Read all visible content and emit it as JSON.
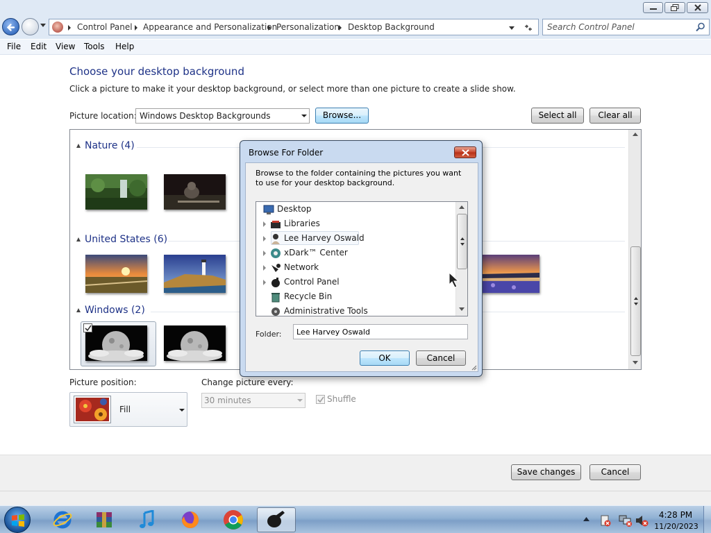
{
  "address_bar": {
    "crumbs": [
      "Control Panel",
      "Appearance and Personalization",
      "Personalization",
      "Desktop Background"
    ],
    "search_placeholder": "Search Control Panel"
  },
  "menu": [
    "File",
    "Edit",
    "View",
    "Tools",
    "Help"
  ],
  "main": {
    "title": "Choose your desktop background",
    "instructions": "Click a picture to make it your desktop background, or select more than one picture to create a slide show.",
    "picture_location_label": "Picture location:",
    "picture_location_value": "Windows Desktop Backgrounds",
    "browse_label": "Browse...",
    "select_all_label": "Select all",
    "clear_all_label": "Clear all"
  },
  "gallery": {
    "groups": [
      {
        "name": "Nature (4)",
        "thumbnails": [
          "jungle waterfall",
          "cat in dark grass"
        ]
      },
      {
        "name": "United States (6)",
        "thumbnails": [
          "sunset over field",
          "lighthouse on rocks",
          "lupine lake at dusk"
        ]
      },
      {
        "name": "Windows (2)",
        "thumbnails": [
          "moon over clouds (selected)",
          "moon over clouds"
        ]
      }
    ],
    "selected_count": 1
  },
  "options": {
    "position_label": "Picture position:",
    "position_value": "Fill",
    "interval_label": "Change picture every:",
    "interval_value": "30 minutes",
    "shuffle_label": "Shuffle",
    "shuffle_checked": true
  },
  "footer": {
    "save_label": "Save changes",
    "cancel_label": "Cancel"
  },
  "dialog": {
    "title": "Browse For Folder",
    "description": "Browse to the folder containing the pictures you want to use for your desktop background.",
    "tree": [
      {
        "label": "Desktop",
        "icon": "desktop-icon"
      },
      {
        "label": "Libraries",
        "icon": "libraries-icon"
      },
      {
        "label": "Lee Harvey Oswald",
        "icon": "user-icon"
      },
      {
        "label": "xDark™ Center",
        "icon": "xdark-icon"
      },
      {
        "label": "Network",
        "icon": "network-icon"
      },
      {
        "label": "Control Panel",
        "icon": "control-panel-icon"
      },
      {
        "label": "Recycle Bin",
        "icon": "recycle-bin-icon"
      },
      {
        "label": "Administrative Tools",
        "icon": "admin-tools-icon"
      }
    ],
    "selected_item": "Lee Harvey Oswald",
    "folder_label": "Folder:",
    "folder_value": "Lee Harvey Oswald",
    "ok_label": "OK",
    "cancel_label": "Cancel"
  },
  "taskbar": {
    "apps": [
      "internet-explorer",
      "winrar",
      "itunes",
      "firefox",
      "chrome",
      "xdark-center"
    ],
    "active_app": "xdark-center",
    "time": "4:28 PM",
    "date": "11/20/2023"
  },
  "colors": {
    "title_blue": "#1e3287",
    "chrome": "#dfe9f5",
    "dialog_frame": "#c9daf0"
  }
}
